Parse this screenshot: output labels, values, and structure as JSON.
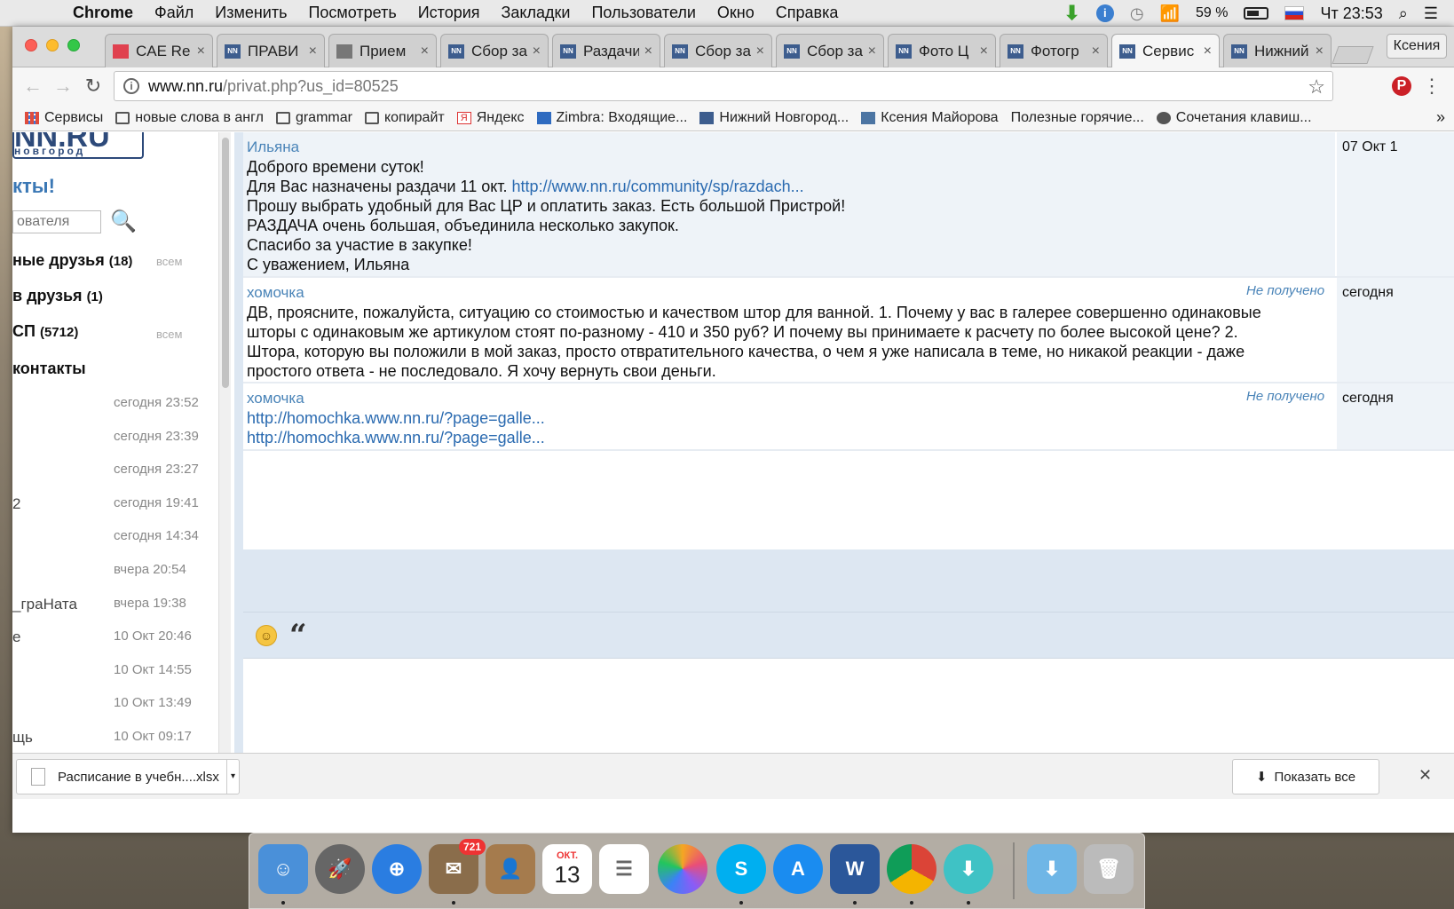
{
  "menubar": {
    "app": "Chrome",
    "items": [
      "Файл",
      "Изменить",
      "Посмотреть",
      "История",
      "Закладки",
      "Пользователи",
      "Окно",
      "Справка"
    ],
    "battery": "59 %",
    "clock": "Чт 23:53"
  },
  "tabs": [
    {
      "label": "CAE Re",
      "icon": "red"
    },
    {
      "label": "ПРАВИ",
      "icon": "nn"
    },
    {
      "label": "Прием",
      "icon": "gray"
    },
    {
      "label": "Сбор за",
      "icon": "nn"
    },
    {
      "label": "Раздачи",
      "icon": "nn"
    },
    {
      "label": "Сбор за",
      "icon": "nn"
    },
    {
      "label": "Сбор за",
      "icon": "nn"
    },
    {
      "label": "Фото Ц",
      "icon": "nn"
    },
    {
      "label": "Фотогр",
      "icon": "nn"
    },
    {
      "label": "Сервис",
      "icon": "nn",
      "active": true
    },
    {
      "label": "Нижний",
      "icon": "nn"
    }
  ],
  "profile_name": "Ксения",
  "address": {
    "host": "www.nn.ru",
    "path": "/privat.php?us_id=80525"
  },
  "bookmarks": [
    {
      "label": "Сервисы",
      "icon": "grid"
    },
    {
      "label": "новые слова в англ",
      "icon": "folder"
    },
    {
      "label": "grammar",
      "icon": "folder"
    },
    {
      "label": "копирайт",
      "icon": "folder"
    },
    {
      "label": "Яндекс",
      "icon": "ya"
    },
    {
      "label": "Zimbra: Входящие...",
      "icon": "zim"
    },
    {
      "label": "Нижний Новгород...",
      "icon": "nn"
    },
    {
      "label": "Ксения Майорова",
      "icon": "vk"
    },
    {
      "label": "Полезные горячие...",
      "icon": "page"
    },
    {
      "label": "Сочетания клавиш...",
      "icon": "apple"
    }
  ],
  "sidebar": {
    "logo_big": "NN.RU",
    "logo_small": "новгород",
    "heading": "кты!",
    "search_placeholder": "ователя",
    "groups": [
      {
        "label": "ные друзья",
        "count": "(18)",
        "all": "всем"
      },
      {
        "label": "в друзья",
        "count": "(1)"
      },
      {
        "label": "СП",
        "count": "(5712)",
        "all": "всем"
      },
      {
        "label": "контакты",
        "count": ""
      }
    ],
    "contacts": [
      {
        "who": "",
        "when": "сегодня 23:52"
      },
      {
        "who": "",
        "when": "сегодня 23:39"
      },
      {
        "who": "",
        "when": "сегодня 23:27"
      },
      {
        "who": "2",
        "when": "сегодня 19:41"
      },
      {
        "who": "",
        "when": "сегодня 14:34"
      },
      {
        "who": "",
        "when": "вчера 20:54"
      },
      {
        "who": "_граНата",
        "when": "вчера 19:38"
      },
      {
        "who": "е",
        "when": "10 Окт 20:46"
      },
      {
        "who": "",
        "when": "10 Окт 14:55"
      },
      {
        "who": "",
        "when": "10 Окт 13:49"
      },
      {
        "who": "щь",
        "when": "10 Окт 09:17"
      }
    ]
  },
  "messages": [
    {
      "author": "Ильяна",
      "status": "",
      "date": "07 Окт 1",
      "lines": [
        {
          "text": "Доброго времени суток!"
        },
        {
          "text": "Для Вас назначены раздачи 11 окт. ",
          "link": "http://www.nn.ru/community/sp/razdach..."
        },
        {
          "text": "Прошу выбрать удобный для Вас ЦР и оплатить заказ. Есть большой Пристрой!"
        },
        {
          "text": "РАЗДАЧА очень большая, объединила несколько закупок."
        },
        {
          "text": "Спасибо за участие в закупке!"
        },
        {
          "text": "С уважением, Ильяна"
        }
      ]
    },
    {
      "author": "хомочка",
      "status": "Не получено",
      "date": "сегодня",
      "lines": [
        {
          "text": "ДВ, проясните, пожалуйста, ситуацию со стоимостью и качеством штор для ванной. 1. Почему у вас в галерее совершенно одинаковые"
        },
        {
          "text": "шторы с одинаковым же артикулом стоят по-разному - 410 и 350 руб? И почему вы принимаете к расчету по более высокой цене? 2."
        },
        {
          "text": "Штора, которую вы положили в мой заказ, просто отвратительного качества, о чем я уже написала в теме, но никакой реакции - даже"
        },
        {
          "text": "простого ответа - не последовало. Я хочу вернуть свои деньги."
        }
      ]
    },
    {
      "author": "хомочка",
      "status": "Не получено",
      "date": "сегодня",
      "lines": [
        {
          "text": "",
          "link": "http://homochka.www.nn.ru/?page=galle..."
        },
        {
          "text": "",
          "link": "http://homochka.www.nn.ru/?page=galle..."
        }
      ]
    }
  ],
  "reply": {
    "quote_glyph": "“"
  },
  "download": {
    "filename": "Расписание в учебн....xlsx",
    "show_all": "Показать все"
  },
  "dock": {
    "mail_badge": "721",
    "calendar_month": "ОКТ.",
    "calendar_day": "13"
  }
}
